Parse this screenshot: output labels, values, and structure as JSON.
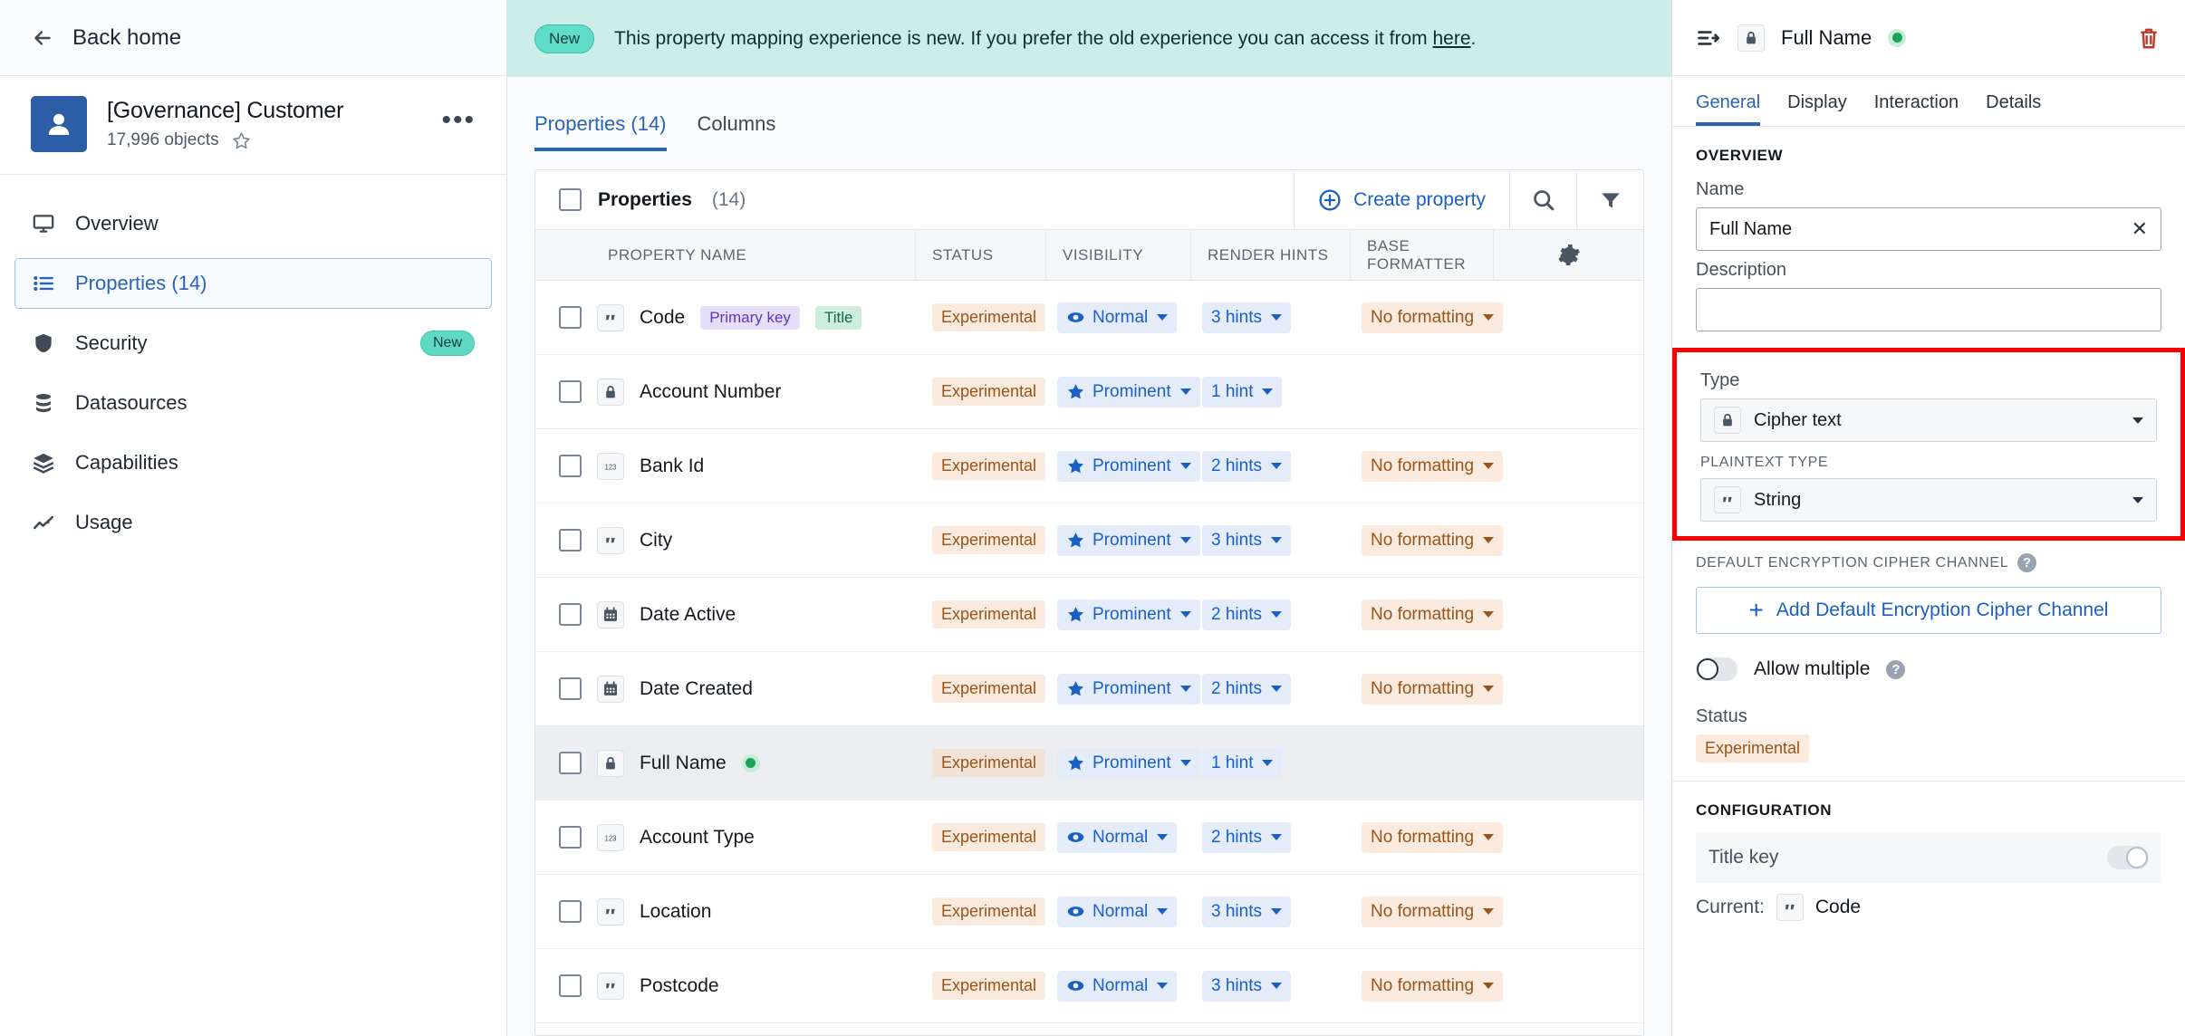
{
  "sidebar": {
    "back_label": "Back home",
    "object_title": "[Governance] Customer",
    "object_count": "17,996 objects",
    "items": [
      {
        "label": "Overview",
        "icon": "monitor-icon",
        "active": false,
        "badge": ""
      },
      {
        "label": "Properties (14)",
        "icon": "list-icon",
        "active": true,
        "badge": ""
      },
      {
        "label": "Security",
        "icon": "shield-icon",
        "active": false,
        "badge": "New"
      },
      {
        "label": "Datasources",
        "icon": "database-icon",
        "active": false,
        "badge": ""
      },
      {
        "label": "Capabilities",
        "icon": "layers-icon",
        "active": false,
        "badge": ""
      },
      {
        "label": "Usage",
        "icon": "chart-line-icon",
        "active": false,
        "badge": ""
      }
    ]
  },
  "banner": {
    "pill": "New",
    "text_before": "This property mapping experience is new. If you prefer the old experience you can access it from ",
    "link": "here",
    "text_after": "."
  },
  "tabs": [
    {
      "label": "Properties (14)",
      "active": true
    },
    {
      "label": "Columns",
      "active": false
    }
  ],
  "toolbar": {
    "title": "Properties",
    "count": "(14)",
    "create_label": "Create property",
    "search_icon": "search-icon",
    "filter_icon": "filter-icon",
    "gear_icon": "gear-icon"
  },
  "table": {
    "columns": [
      "PROPERTY NAME",
      "STATUS",
      "VISIBILITY",
      "RENDER HINTS",
      "BASE FORMATTER"
    ],
    "rows": [
      {
        "name": "Code",
        "type_icon": "string-icon",
        "tags": [
          {
            "text": "Primary key",
            "kind": "pk"
          },
          {
            "text": "Title",
            "kind": "title"
          }
        ],
        "dot": false,
        "status": "Experimental",
        "visibility": "Normal",
        "vis_icon": "eye-icon",
        "hints": "3 hints",
        "formatter": "No formatting",
        "selected": false
      },
      {
        "name": "Account Number",
        "type_icon": "lock-icon",
        "tags": [],
        "dot": false,
        "status": "Experimental",
        "visibility": "Prominent",
        "vis_icon": "star-icon",
        "hints": "1 hint",
        "formatter": "",
        "selected": false
      },
      {
        "name": "Bank Id",
        "type_icon": "number-icon",
        "tags": [],
        "dot": false,
        "status": "Experimental",
        "visibility": "Prominent",
        "vis_icon": "star-icon",
        "hints": "2 hints",
        "formatter": "No formatting",
        "selected": false
      },
      {
        "name": "City",
        "type_icon": "string-icon",
        "tags": [],
        "dot": false,
        "status": "Experimental",
        "visibility": "Prominent",
        "vis_icon": "star-icon",
        "hints": "3 hints",
        "formatter": "No formatting",
        "selected": false
      },
      {
        "name": "Date Active",
        "type_icon": "calendar-icon",
        "tags": [],
        "dot": false,
        "status": "Experimental",
        "visibility": "Prominent",
        "vis_icon": "star-icon",
        "hints": "2 hints",
        "formatter": "No formatting",
        "selected": false
      },
      {
        "name": "Date Created",
        "type_icon": "calendar-icon",
        "tags": [],
        "dot": false,
        "status": "Experimental",
        "visibility": "Prominent",
        "vis_icon": "star-icon",
        "hints": "2 hints",
        "formatter": "No formatting",
        "selected": false
      },
      {
        "name": "Full Name",
        "type_icon": "lock-icon",
        "tags": [],
        "dot": true,
        "status": "Experimental",
        "visibility": "Prominent",
        "vis_icon": "star-icon",
        "hints": "1 hint",
        "formatter": "",
        "selected": true
      },
      {
        "name": "Account Type",
        "type_icon": "number-icon",
        "tags": [],
        "dot": false,
        "status": "Experimental",
        "visibility": "Normal",
        "vis_icon": "eye-icon",
        "hints": "2 hints",
        "formatter": "No formatting",
        "selected": false
      },
      {
        "name": "Location",
        "type_icon": "string-icon",
        "tags": [],
        "dot": false,
        "status": "Experimental",
        "visibility": "Normal",
        "vis_icon": "eye-icon",
        "hints": "3 hints",
        "formatter": "No formatting",
        "selected": false
      },
      {
        "name": "Postcode",
        "type_icon": "string-icon",
        "tags": [],
        "dot": false,
        "status": "Experimental",
        "visibility": "Normal",
        "vis_icon": "eye-icon",
        "hints": "3 hints",
        "formatter": "No formatting",
        "selected": false
      }
    ]
  },
  "panel": {
    "title": "Full Name",
    "type_icon": "lock-icon",
    "collapse_icon": "panel-collapse-icon",
    "delete_icon": "trash-icon",
    "tabs": [
      {
        "label": "General",
        "active": true
      },
      {
        "label": "Display",
        "active": false
      },
      {
        "label": "Interaction",
        "active": false
      },
      {
        "label": "Details",
        "active": false
      }
    ],
    "overview_label": "OVERVIEW",
    "name_label": "Name",
    "name_value": "Full Name",
    "description_label": "Description",
    "description_value": "",
    "type_label": "Type",
    "type_value": "Cipher text",
    "plaintext_label": "PLAINTEXT TYPE",
    "plaintext_value": "String",
    "cipher_channel_label": "DEFAULT ENCRYPTION CIPHER CHANNEL",
    "add_channel_label": "Add Default Encryption Cipher Channel",
    "allow_multiple_label": "Allow multiple",
    "allow_multiple_on": false,
    "status_label": "Status",
    "status_value": "Experimental",
    "configuration_label": "CONFIGURATION",
    "title_key_label": "Title key",
    "title_key_on": false,
    "current_label": "Current:",
    "current_value": "Code",
    "current_icon": "string-icon"
  },
  "colors": {
    "accent": "#2a64b5",
    "link": "#1a5fc4",
    "banner_bg": "#cdeee8",
    "status_bg": "#fbeade",
    "status_fg": "#9a5418",
    "highlight_border": "#fb0000",
    "brand_tile": "#2b5ea7"
  }
}
